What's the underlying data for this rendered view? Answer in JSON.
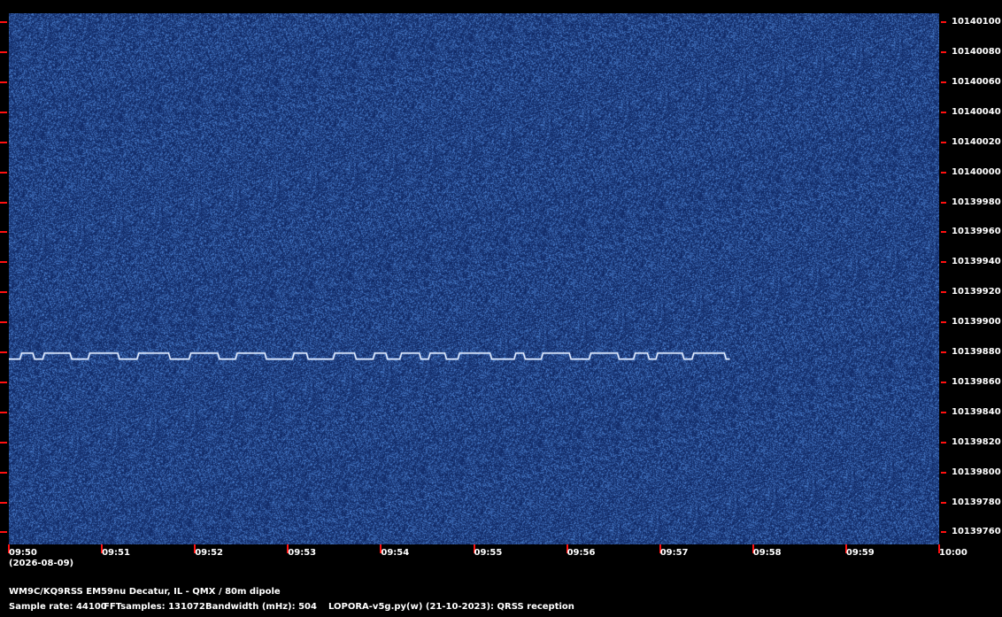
{
  "chart_data": {
    "type": "heatmap",
    "title": "WM9C/KQ9RSS EM59nu Decatur, IL - QMX / 80m dipole",
    "x_ticks": [
      "09:50",
      "09:51",
      "09:52",
      "09:53",
      "09:54",
      "09:55",
      "09:56",
      "09:57",
      "09:58",
      "09:59",
      "10:00"
    ],
    "x_date_label": "(2026-08-09)",
    "y_ticks": [
      "10140100",
      "10140080",
      "10140060",
      "10140040",
      "10140020",
      "10140000",
      "10139980",
      "10139960",
      "10139940",
      "10139920",
      "10139900",
      "10139880",
      "10139860",
      "10139840",
      "10139820",
      "10139800",
      "10139780",
      "10139760"
    ],
    "ylim": [
      10139752,
      10140106
    ],
    "signal": {
      "base_freq": 10139875.5,
      "high_freq": 10139879.5,
      "start_time": "09:50:00",
      "end_time": "09:57:45",
      "description_levels": "frequency-shift keyed trace alternating between two levels"
    },
    "colors": {
      "background": "#173a78",
      "noise_light": "#3b6fc0",
      "signal": "#e8f0ff",
      "tick": "#ff1010"
    }
  },
  "footer": {
    "station": "WM9C/KQ9RSS EM59nu Decatur, IL - QMX / 80m dipole",
    "sample_rate": "Sample rate: 44100",
    "fft_samples": "FFTsamples: 131072",
    "bandwidth": "Bandwidth (mHz): 504",
    "software": "LOPORA-v5g.py(w) (21-10-2023): QRSS reception"
  }
}
